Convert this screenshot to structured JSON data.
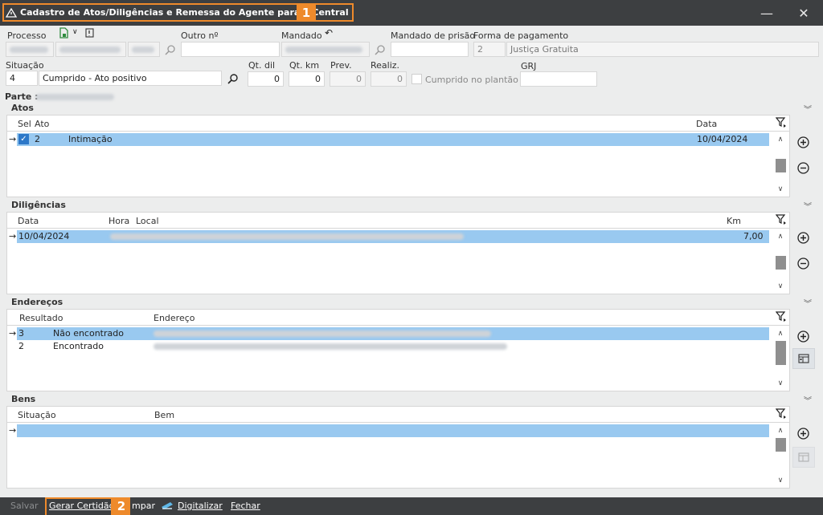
{
  "window": {
    "title": "Cadastro de Atos/Diligências e Remessa do Agente para a Central",
    "badge1": "1",
    "badge2": "2",
    "minimize": "—",
    "close": "✕"
  },
  "form": {
    "processo_label": "Processo",
    "outro_label": "Outro nº",
    "mandado_label": "Mandado",
    "mandado_prisao_label": "Mandado de prisão",
    "forma_pagamento_label": "Forma de pagamento",
    "forma_pagamento_code": "2",
    "forma_pagamento_value": "Justiça Gratuita",
    "situacao_label": "Situação",
    "situacao_code": "4",
    "situacao_value": "Cumprido - Ato positivo",
    "qt_dil_label": "Qt. dil",
    "qt_dil_value": "0",
    "qt_km_label": "Qt. km",
    "qt_km_value": "0",
    "prev_label": "Prev.",
    "prev_value": "0",
    "realiz_label": "Realiz.",
    "realiz_value": "0",
    "cumprido_plantao_label": "Cumprido no plantão",
    "grj_label": "GRJ",
    "parte_label": "Parte :"
  },
  "atos": {
    "title": "Atos",
    "columns": [
      "Sel",
      "Ato",
      "Data"
    ],
    "rows": [
      {
        "code": "2",
        "ato": "Intimação",
        "data": "10/04/2024",
        "selected": true
      }
    ]
  },
  "diligencias": {
    "title": "Diligências",
    "columns": [
      "Data",
      "Hora",
      "Local",
      "Km"
    ],
    "rows": [
      {
        "data": "10/04/2024",
        "km": "7,00"
      }
    ]
  },
  "enderecos": {
    "title": "Endereços",
    "columns": [
      "Resultado",
      "Endereço"
    ],
    "rows": [
      {
        "code": "3",
        "resultado": "Não encontrado"
      },
      {
        "code": "2",
        "resultado": "Encontrado"
      }
    ]
  },
  "bens": {
    "title": "Bens",
    "columns": [
      "Situação",
      "Bem"
    ]
  },
  "footer": {
    "salvar": "Salvar",
    "gerar_certidao": "Gerar Certidão",
    "limpar": "mpar",
    "digitalizar": "Digitalizar",
    "fechar": "Fechar"
  },
  "colors": {
    "accent": "#ee8a2b",
    "selection": "#99c9f0",
    "titlebar": "#3d3f41"
  }
}
